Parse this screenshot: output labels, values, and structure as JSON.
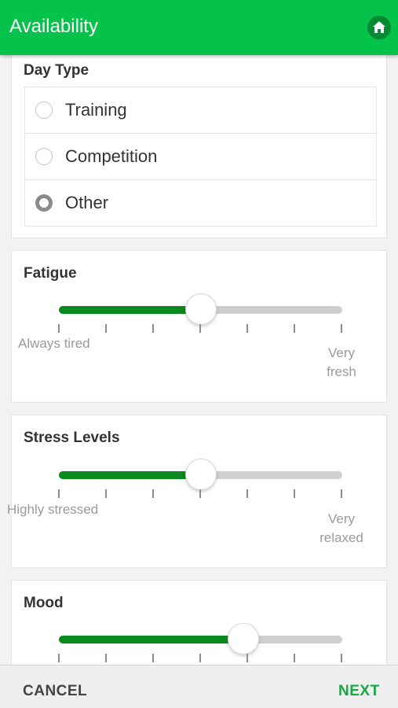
{
  "appbar": {
    "title": "Availability",
    "home_icon": "home-icon"
  },
  "day_type": {
    "title": "Day Type",
    "options": [
      {
        "label": "Training",
        "selected": false
      },
      {
        "label": "Competition",
        "selected": false
      },
      {
        "label": "Other",
        "selected": true
      }
    ]
  },
  "fatigue": {
    "title": "Fatigue",
    "min_label": "Always tired",
    "max_label_1": "Very",
    "max_label_2": "fresh",
    "value": 0.5
  },
  "stress": {
    "title": "Stress Levels",
    "min_label": "Highly stressed",
    "max_label_1": "Very",
    "max_label_2": "relaxed",
    "value": 0.5
  },
  "mood": {
    "title": "Mood",
    "value": 0.65
  },
  "footer": {
    "cancel_label": "CANCEL",
    "next_label": "NEXT"
  },
  "colors": {
    "accent": "#05c24a",
    "slider_fill": "#0a8a1c",
    "next": "#17a843"
  }
}
